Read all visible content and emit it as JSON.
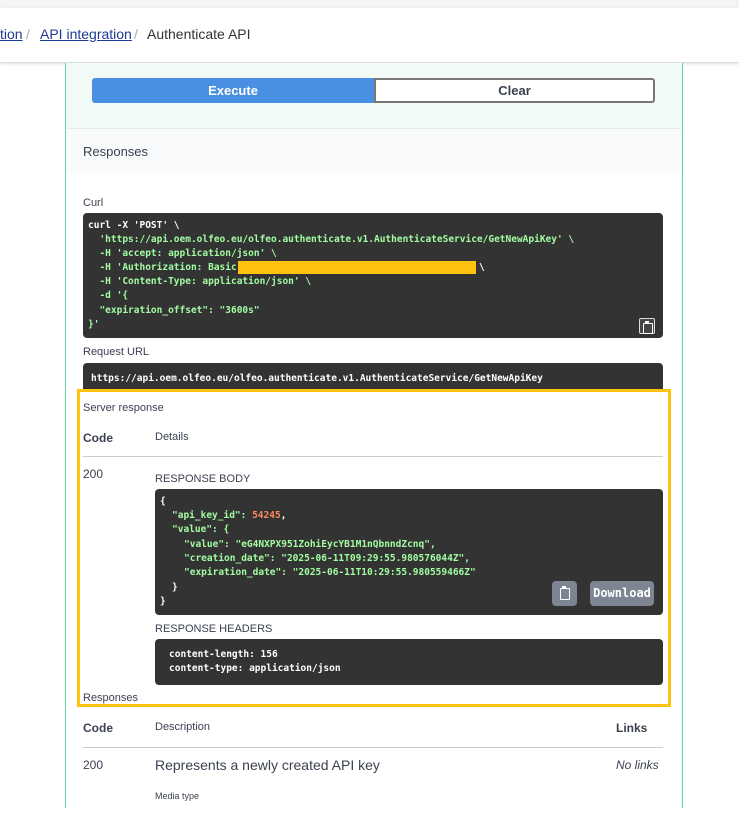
{
  "breadcrumb": {
    "items": [
      "tion",
      "API integration",
      "Authenticate API"
    ],
    "separator": "/"
  },
  "actions": {
    "execute": "Execute",
    "clear": "Clear"
  },
  "responses_section": {
    "title": "Responses"
  },
  "curl": {
    "label": "Curl",
    "lines": [
      "curl -X 'POST' \\",
      "  'https://api.oem.olfeo.eu/olfeo.authenticate.v1.AuthenticateService/GetNewApiKey' \\",
      "  -H 'accept: application/json' \\",
      "  -H 'Authorization: Basic",
      "  -H 'Content-Type: application/json' \\",
      "  -d '{",
      "  \"expiration_offset\": \"3600s\"",
      "}'"
    ],
    "line_continuation": "\\"
  },
  "request_url": {
    "label": "Request URL",
    "value": "https://api.oem.olfeo.eu/olfeo.authenticate.v1.AuthenticateService/GetNewApiKey"
  },
  "server_response": {
    "label": "Server response",
    "col_code": "Code",
    "col_details": "Details",
    "code": "200",
    "body_label": "RESPONSE BODY",
    "body": {
      "open": "{",
      "api_key_id_key": "\"api_key_id\": ",
      "api_key_id_val": "54245",
      "value_key": "\"value\": {",
      "value_k": "\"value\": ",
      "value_v": "\"eG4NXPX951ZohiEycYB1M1nQbnndZcnq\",",
      "creation_k": "\"creation_date\": ",
      "creation_v": "\"2025-06-11T09:29:55.980576044Z\",",
      "expiration_k": "\"expiration_date\": ",
      "expiration_v": "\"2025-06-11T10:29:55.980559466Z\"",
      "inner_close": "}",
      "close": "}"
    },
    "download": "Download",
    "headers_label": "RESPONSE HEADERS",
    "headers": [
      "content-length: 156",
      "content-type: application/json"
    ]
  },
  "responses": {
    "label": "Responses",
    "col_code": "Code",
    "col_description": "Description",
    "col_links": "Links",
    "code": "200",
    "description": "Represents a newly created API key",
    "links": "No links",
    "media_type": "Media type"
  },
  "colors": {
    "accent": "#4990e2",
    "highlight": "#ffc20e",
    "border": "#61d6a3",
    "code_bg": "#333333"
  }
}
